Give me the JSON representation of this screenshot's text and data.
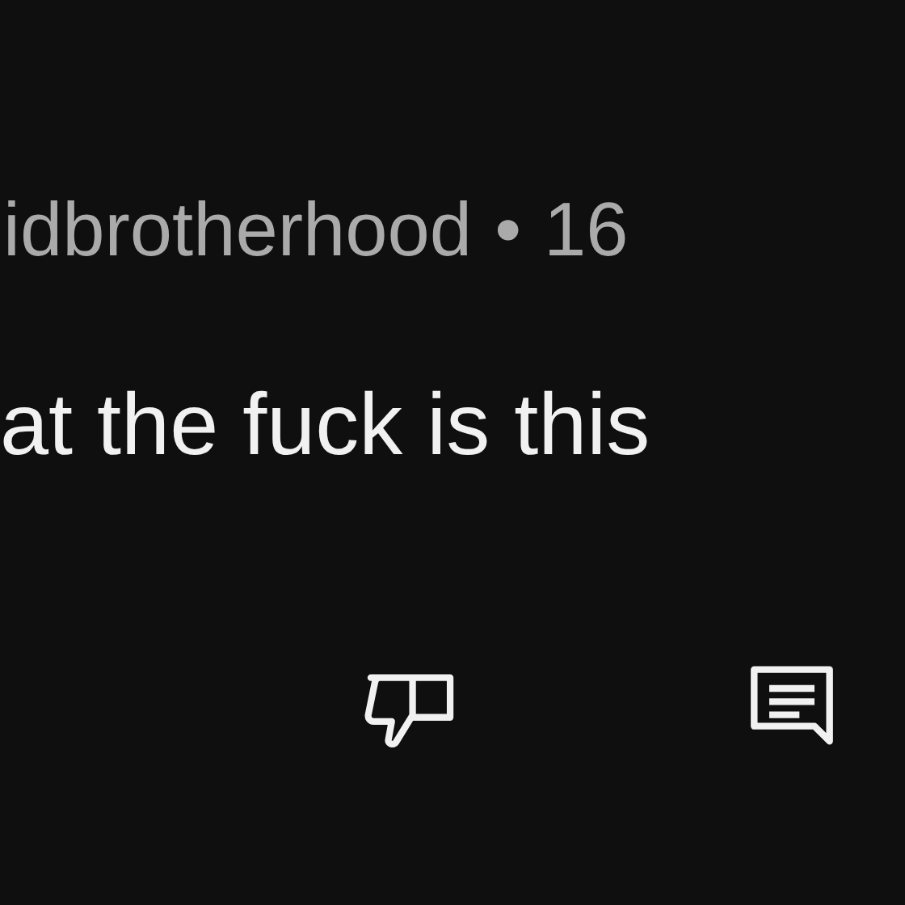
{
  "comment": {
    "author": "idbrotherhood",
    "separator": "•",
    "time": "16",
    "text": "at the fuck is this"
  }
}
